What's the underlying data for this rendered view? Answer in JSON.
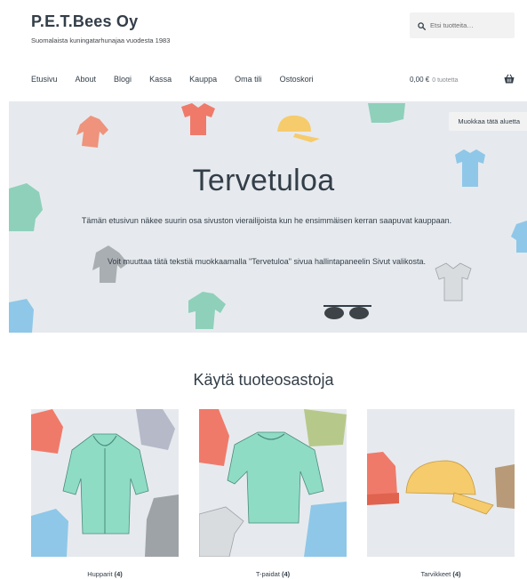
{
  "site": {
    "title": "P.E.T.Bees Oy",
    "description": "Suomalaista kuningatarhunajaa vuodesta 1983"
  },
  "search": {
    "placeholder": "Etsi tuotteita…"
  },
  "nav": {
    "items": [
      "Etusivu",
      "About",
      "Blogi",
      "Kassa",
      "Kauppa",
      "Oma tili",
      "Ostoskori"
    ]
  },
  "cart": {
    "amount": "0,00 €",
    "count": "0 tuotetta"
  },
  "hero": {
    "edit_label": "Muokkaa tätä aluetta",
    "title": "Tervetuloa",
    "text": "Tämän etusivun näkee suurin osa sivuston vierailijoista kun he ensimmäisen kerran saapuvat kauppaan.",
    "text2": "Voit muuttaa tätä tekstiä muokkaamalla \"Tervetuloa\" sivua hallintapaneelin Sivut valikosta."
  },
  "categories": {
    "title": "Käytä tuoteosastoja",
    "items": [
      {
        "name": "Hupparit",
        "count": "(4)"
      },
      {
        "name": "T-paidat",
        "count": "(4)"
      },
      {
        "name": "Tarvikkeet",
        "count": "(4)"
      }
    ]
  },
  "colors": {
    "text": "#333e48",
    "hero_bg": "#e6eaee",
    "search_bg": "#f2f2f2"
  }
}
